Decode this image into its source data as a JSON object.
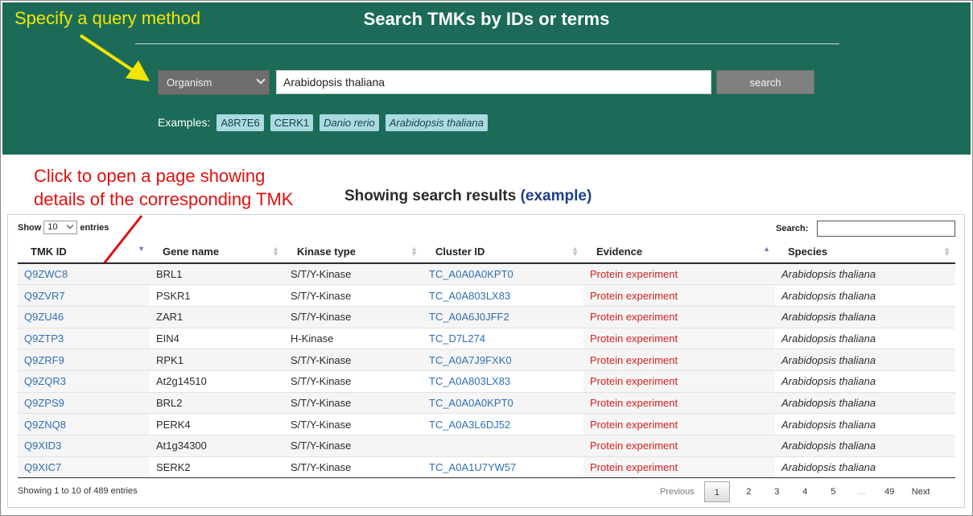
{
  "header": {
    "title": "Search TMKs by IDs or terms",
    "query_method": "Organism",
    "query_value": "Arabidopsis thaliana",
    "search_label": "search",
    "examples_label": "Examples:",
    "examples": [
      "A8R7E6",
      "CERK1",
      "Danio rerio",
      "Arabidopsis thaliana"
    ]
  },
  "annotations": {
    "query_hint": "Specify a query method",
    "click_hint_line1": "Click to open a page showing",
    "click_hint_line2": "details of the corresponding TMK"
  },
  "results": {
    "heading": "Showing search results",
    "example_link": "(example)"
  },
  "table": {
    "show_label": "Show",
    "length_value": "10",
    "entries_label": "entries",
    "search_label": "Search:",
    "columns": [
      "TMK ID",
      "Gene name",
      "Kinase type",
      "Cluster ID",
      "Evidence",
      "Species"
    ],
    "rows": [
      [
        "Q9ZWC8",
        "BRL1",
        "S/T/Y-Kinase",
        "TC_A0A0A0KPT0",
        "Protein experiment",
        "Arabidopsis thaliana"
      ],
      [
        "Q9ZVR7",
        "PSKR1",
        "S/T/Y-Kinase",
        "TC_A0A803LX83",
        "Protein experiment",
        "Arabidopsis thaliana"
      ],
      [
        "Q9ZU46",
        "ZAR1",
        "S/T/Y-Kinase",
        "TC_A0A6J0JFF2",
        "Protein experiment",
        "Arabidopsis thaliana"
      ],
      [
        "Q9ZTP3",
        "EIN4",
        "H-Kinase",
        "TC_D7L274",
        "Protein experiment",
        "Arabidopsis thaliana"
      ],
      [
        "Q9ZRF9",
        "RPK1",
        "S/T/Y-Kinase",
        "TC_A0A7J9FXK0",
        "Protein experiment",
        "Arabidopsis thaliana"
      ],
      [
        "Q9ZQR3",
        "At2g14510",
        "S/T/Y-Kinase",
        "TC_A0A803LX83",
        "Protein experiment",
        "Arabidopsis thaliana"
      ],
      [
        "Q9ZPS9",
        "BRL2",
        "S/T/Y-Kinase",
        "TC_A0A0A0KPT0",
        "Protein experiment",
        "Arabidopsis thaliana"
      ],
      [
        "Q9ZNQ8",
        "PERK4",
        "S/T/Y-Kinase",
        "TC_A0A3L6DJ52",
        "Protein experiment",
        "Arabidopsis thaliana"
      ],
      [
        "Q9XID3",
        "At1g34300",
        "S/T/Y-Kinase",
        "",
        "Protein experiment",
        "Arabidopsis thaliana"
      ],
      [
        "Q9XIC7",
        "SERK2",
        "S/T/Y-Kinase",
        "TC_A0A1U7YW57",
        "Protein experiment",
        "Arabidopsis thaliana"
      ]
    ],
    "info": "Showing 1 to 10 of 489 entries"
  },
  "pagination": {
    "previous": "Previous",
    "pages": [
      "1",
      "2",
      "3",
      "4",
      "5",
      "…",
      "49"
    ],
    "next": "Next",
    "current": "1"
  },
  "colors": {
    "header_bg": "#1b6b58",
    "link": "#2f6fb1",
    "evidence": "#d42020",
    "annotation_yellow": "#f2e600",
    "annotation_red": "#e01010"
  }
}
